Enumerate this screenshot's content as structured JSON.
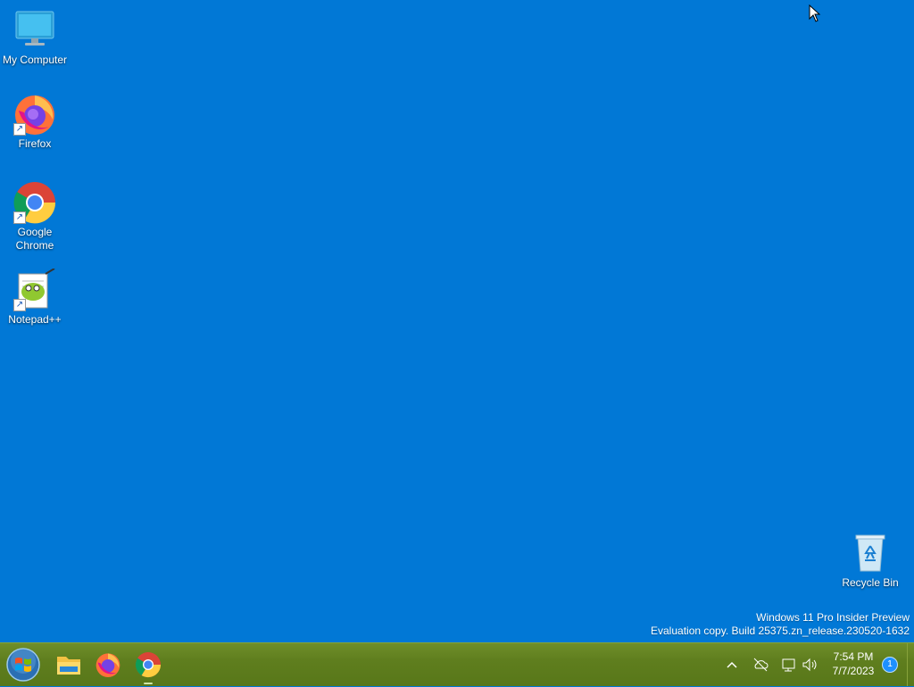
{
  "desktop": {
    "icons": [
      {
        "label": "My Computer",
        "icon": "monitor-icon"
      },
      {
        "label": "Firefox",
        "icon": "firefox-icon"
      },
      {
        "label": "Google Chrome",
        "icon": "chrome-icon"
      },
      {
        "label": "Notepad++",
        "icon": "notepadpp-icon"
      },
      {
        "label": "Recycle Bin",
        "icon": "recycle-bin-icon"
      }
    ],
    "watermark": {
      "line1": "Windows 11 Pro Insider Preview",
      "line2": "Evaluation copy. Build 25375.zn_release.230520-1632"
    },
    "background": "#0178d6"
  },
  "taskbar": {
    "start_icon": "windows-start-orb",
    "pinned": [
      {
        "name": "File Explorer",
        "icon": "folder-icon"
      },
      {
        "name": "Firefox",
        "icon": "firefox-icon"
      },
      {
        "name": "Google Chrome",
        "icon": "chrome-icon",
        "active": true
      }
    ],
    "tray": {
      "icons": [
        "chevron-up-icon",
        "cloud-offline-icon",
        "network-icon",
        "volume-icon"
      ],
      "time": "7:54 PM",
      "date": "7/7/2023",
      "notification_count": "1"
    },
    "color": "#5f7e1e"
  }
}
